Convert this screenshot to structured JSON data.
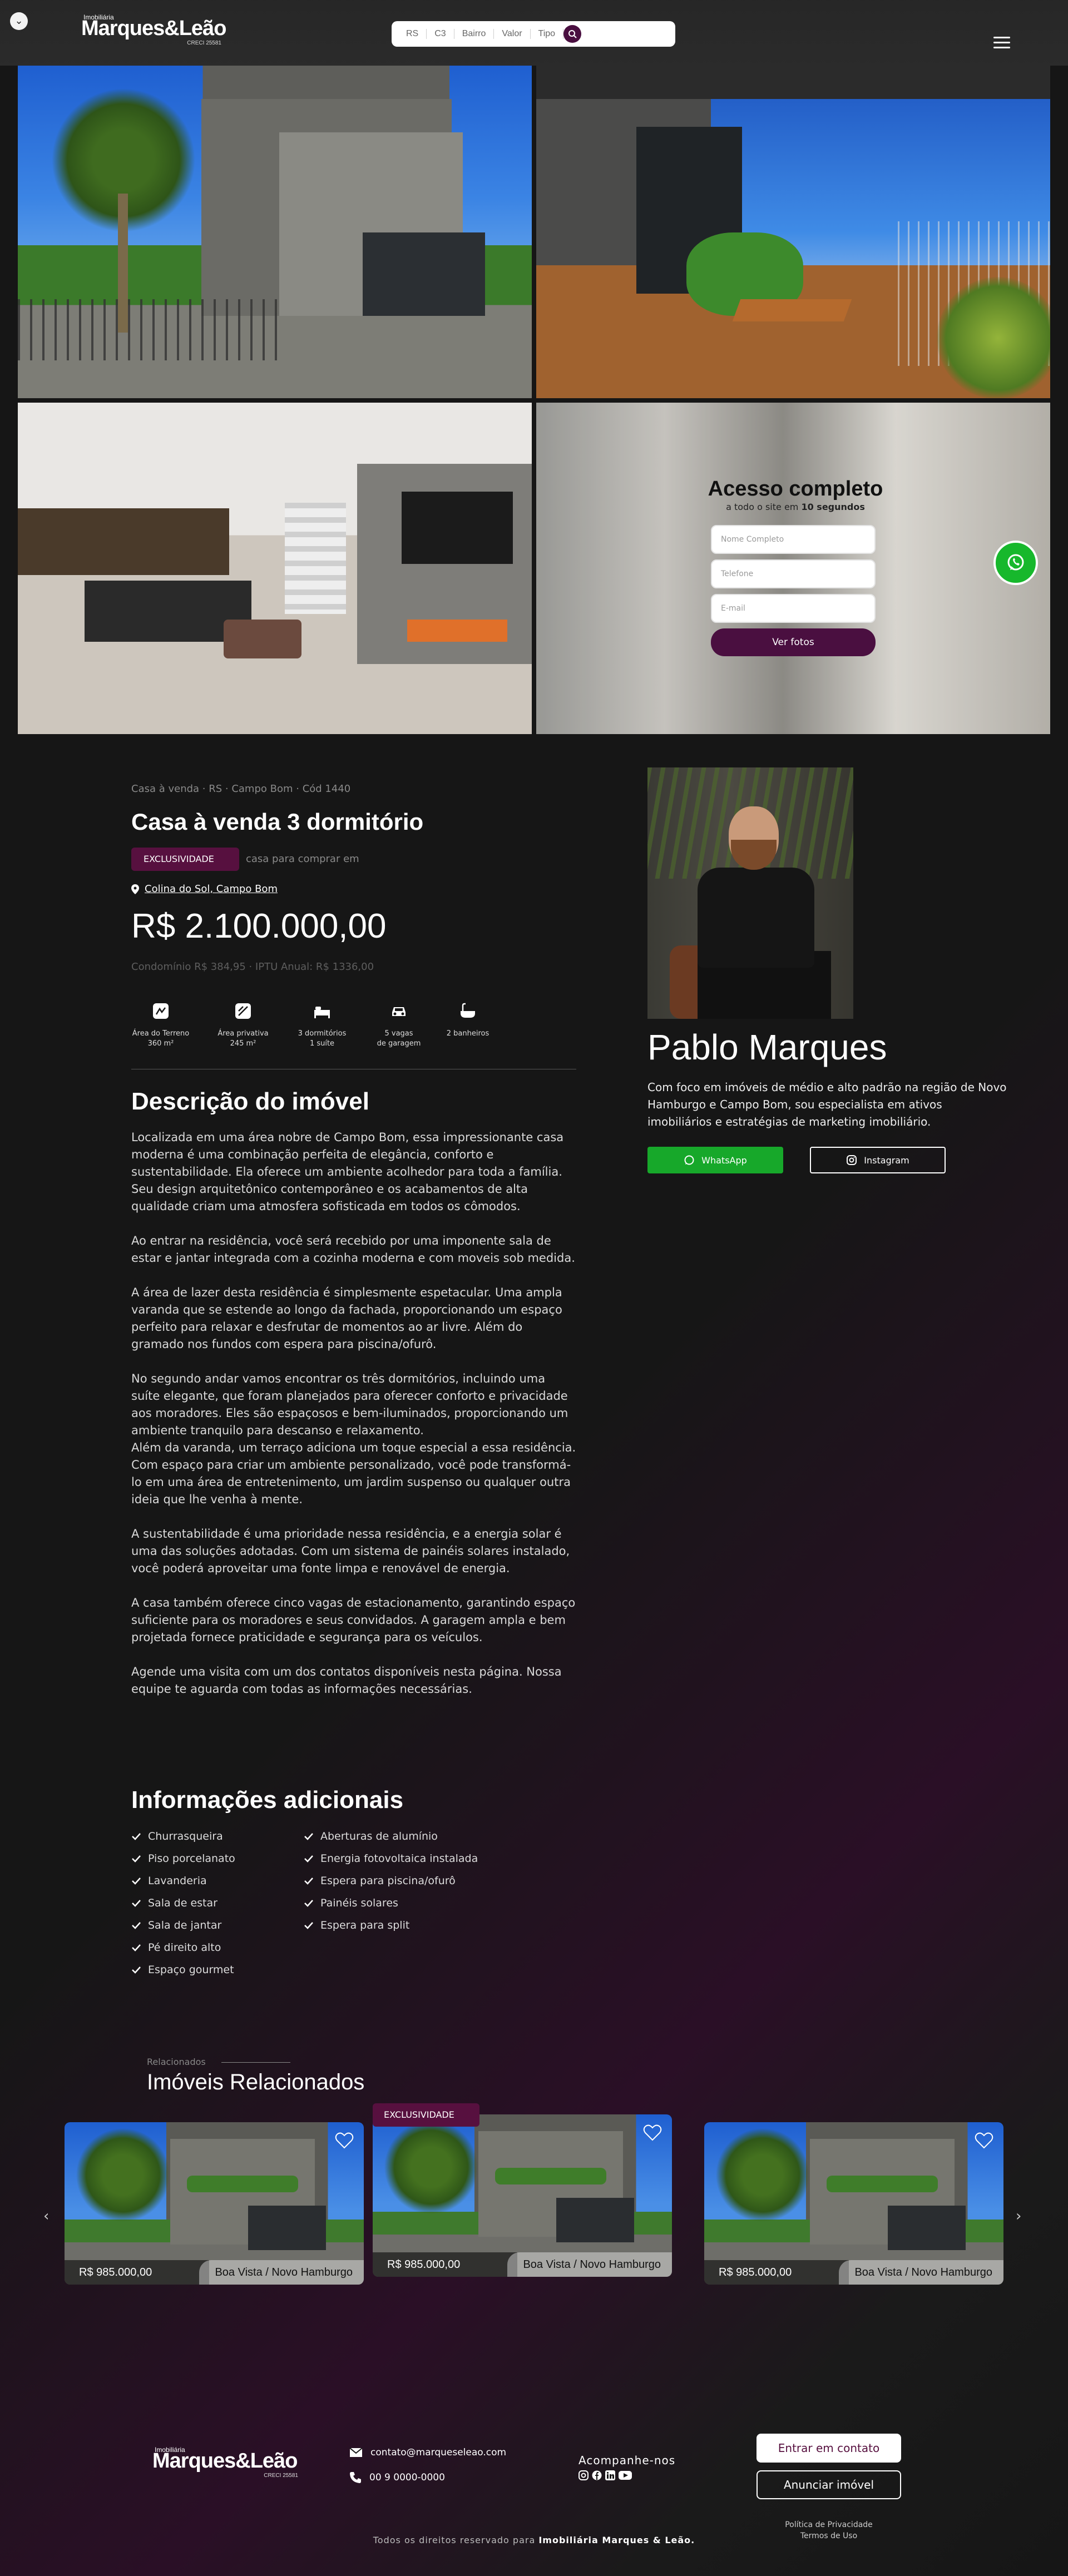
{
  "header": {
    "logo_small": "Imobiliária",
    "logo_main": "Marques&Leão",
    "logo_sub": "CRECI 25581",
    "search_fields": [
      "RS",
      "C3",
      "Bairro",
      "Valor",
      "Tipo"
    ]
  },
  "lead_form": {
    "title": "Acesso completo",
    "subtitle_prefix": "a todo o site em",
    "subtitle_bold": "10 segundos",
    "name_placeholder": "Nome Completo",
    "phone_placeholder": "Telefone",
    "email_placeholder": "E-mail",
    "submit_label": "Ver fotos"
  },
  "property": {
    "breadcrumb": "Casa à venda · RS · Campo Bom · Cód 1440",
    "title": "Casa à venda 3 dormitório",
    "badge": "EXCLUSIVIDADE",
    "badge_note": "casa para comprar em",
    "location": "Colina do Sol, Campo Bom",
    "price": "R$ 2.100.000,00",
    "fees": "Condomínio R$ 384,95 · IPTU Anual: R$ 1336,00",
    "features": [
      {
        "icon": "land-area-icon",
        "line1": "Área do Terreno",
        "line2": "360 m²"
      },
      {
        "icon": "private-area-icon",
        "line1": "Área privativa",
        "line2": "245 m²"
      },
      {
        "icon": "bed-icon",
        "line1": "3 dormitórios",
        "line2": "1 suíte"
      },
      {
        "icon": "car-icon",
        "line1": "5 vagas",
        "line2": "de garagem"
      },
      {
        "icon": "bath-icon",
        "line1": "2 banheiros",
        "line2": ""
      }
    ]
  },
  "description": {
    "title": "Descrição do imóvel",
    "paragraphs": [
      "Localizada em uma área nobre de Campo Bom, essa impressionante casa moderna é uma combinação perfeita de elegância, conforto e sustentabilidade. Ela oferece um ambiente acolhedor para toda a família. Seu design arquitetônico contemporâneo e os acabamentos de alta qualidade criam uma atmosfera sofisticada em todos os cômodos.",
      "Ao entrar na residência, você será recebido por uma imponente sala de estar e jantar  integrada com a cozinha moderna e com moveis sob medida.",
      "A área de lazer desta residência é simplesmente espetacular. Uma ampla varanda que se estende ao longo da fachada, proporcionando um espaço perfeito para relaxar e desfrutar de momentos ao ar livre. Além do gramado nos fundos com espera para piscina/ofurô.",
      "No segundo andar vamos encontrar os três dormitórios, incluindo uma suíte elegante, que foram planejados para oferecer conforto e privacidade aos moradores. Eles são espaçosos e bem-iluminados, proporcionando um ambiente tranquilo para descanso e relaxamento.\nAlém da varanda, um terraço adiciona um toque especial a essa residência. Com espaço para criar um ambiente personalizado, você pode transformá-lo em uma área de entretenimento, um jardim suspenso ou qualquer outra ideia que lhe venha à mente.",
      "A sustentabilidade é uma prioridade nessa residência, e a energia solar é uma das soluções adotadas. Com um sistema de painéis solares instalado, você poderá aproveitar uma fonte limpa e renovável de energia.",
      "A casa também oferece cinco vagas de estacionamento, garantindo espaço suficiente para os moradores e seus convidados. A garagem ampla e bem projetada fornece praticidade e segurança para os veículos.",
      "Agende uma visita com um dos contatos disponíveis nesta página. Nossa equipe te aguarda com todas as informações necessárias."
    ]
  },
  "additional_info": {
    "title": "Informações adicionais",
    "col1": [
      "Churrasqueira",
      "Piso porcelanato",
      "Lavanderia",
      "Sala de estar",
      "Sala de jantar",
      "Pé direito alto",
      "Espaço gourmet"
    ],
    "col2": [
      "Aberturas de alumínio",
      "Energia fotovoltaica instalada",
      "Espera para piscina/ofurô",
      "Painéis solares",
      "Espera para split"
    ]
  },
  "agent": {
    "name": "Pablo Marques",
    "bio": "Com foco em imóveis de médio e alto padrão na região de Novo Hamburgo e Campo Bom, sou especialista em ativos imobiliários e estratégias de marketing imobiliário.",
    "whatsapp_label": "WhatsApp",
    "instagram_label": "Instagram"
  },
  "related": {
    "kicker": "Relacionados",
    "title": "Imóveis Relacionados",
    "badge": "EXCLUSIVIDADE",
    "cards": [
      {
        "price": "R$ 985.000,00",
        "address": "Boa Vista / Novo Hamburgo"
      },
      {
        "price": "R$ 985.000,00",
        "address": "Boa Vista / Novo Hamburgo"
      },
      {
        "price": "R$ 985.000,00",
        "address": "Boa Vista / Novo Hamburgo"
      }
    ]
  },
  "footer": {
    "email": "contato@marqueseleao.com",
    "phone": "00 9 0000-0000",
    "follow_label": "Acompanhe-nos",
    "cta_contact": "Entrar em contato",
    "cta_listing": "Anunciar imóvel",
    "privacy": "Política de Privacidade",
    "terms": "Termos de Uso",
    "copyright_prefix": "Todos os direitos reservado para",
    "copyright_brand": "Imobiliária Marques & Leão."
  },
  "colors": {
    "brand": "#57103f",
    "whatsapp": "#17a82a"
  }
}
